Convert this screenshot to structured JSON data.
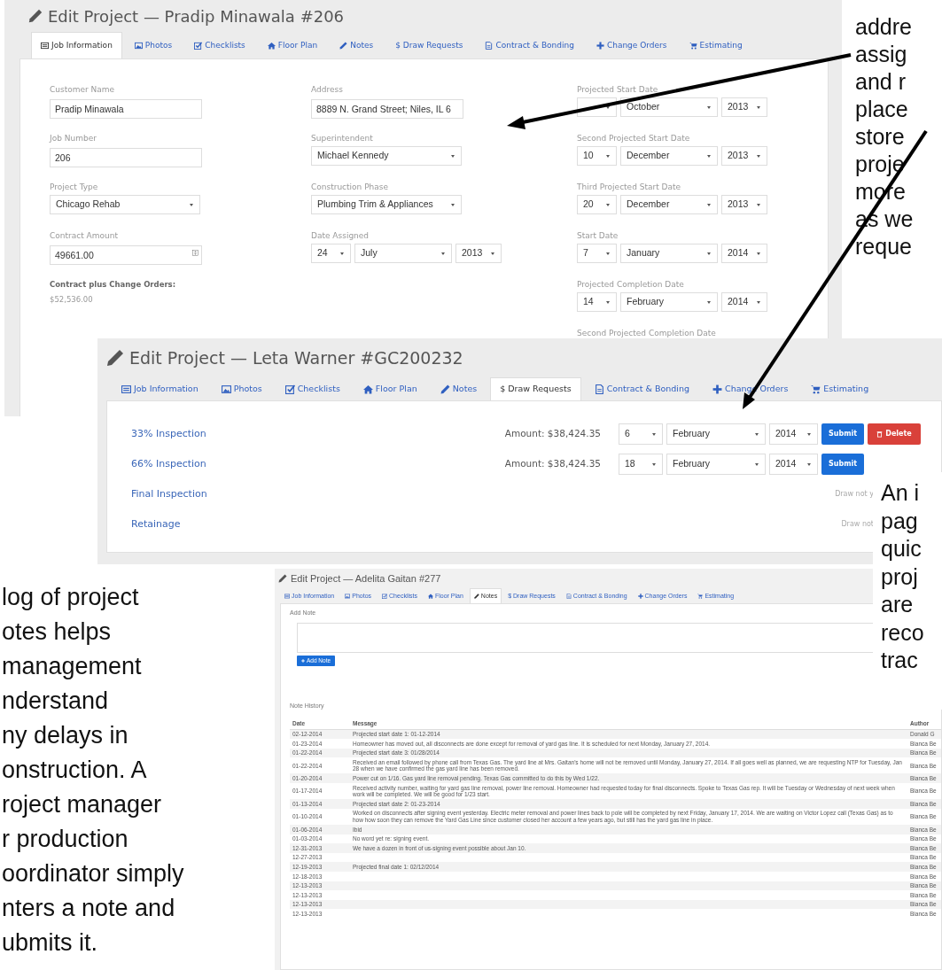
{
  "job_information_screen": {
    "title": "Edit Project — Pradip Minawala #206",
    "tabs": [
      {
        "label": "Job Information",
        "selected": true
      },
      {
        "label": "Photos",
        "selected": false
      },
      {
        "label": "Checklists",
        "selected": false
      },
      {
        "label": "Floor Plan",
        "selected": false
      },
      {
        "label": "Notes",
        "selected": false
      },
      {
        "label": "$ Draw Requests",
        "selected": false
      },
      {
        "label": "Contract & Bonding",
        "selected": false
      },
      {
        "label": "Change Orders",
        "selected": false
      },
      {
        "label": "Estimating",
        "selected": false
      }
    ],
    "columns": [
      [
        {
          "kind": "text",
          "label": "Customer Name",
          "value": "Pradip Minawala"
        },
        {
          "kind": "text",
          "label": "Job Number",
          "value": "206"
        },
        {
          "kind": "select",
          "label": "Project Type",
          "value": "Chicago Rehab"
        },
        {
          "kind": "number",
          "label": "Contract Amount",
          "value": "49661.00"
        },
        {
          "kind": "summary",
          "label": "Contract plus Change Orders:",
          "value": "$52,536.00"
        }
      ],
      [
        {
          "kind": "text",
          "label": "Address",
          "value": "8889 N. Grand Street; Niles, IL 6"
        },
        {
          "kind": "select",
          "label": "Superintendent",
          "value": "Michael Kennedy"
        },
        {
          "kind": "select",
          "label": "Construction Phase",
          "value": "Plumbing Trim & Appliances"
        },
        {
          "kind": "date",
          "label": "Date Assigned",
          "day": "24",
          "month": "July",
          "year": "2013"
        }
      ],
      [
        {
          "kind": "date",
          "label": "Projected Start Date",
          "month": "October",
          "year": "2013"
        },
        {
          "kind": "date",
          "label": "Second Projected Start Date",
          "day": "10",
          "month": "December",
          "year": "2013"
        },
        {
          "kind": "date",
          "label": "Third Projected Start Date",
          "day": "20",
          "month": "December",
          "year": "2013"
        },
        {
          "kind": "date",
          "label": "Start Date",
          "day": "7",
          "month": "January",
          "year": "2014"
        },
        {
          "kind": "date",
          "label": "Projected Completion Date",
          "day": "14",
          "month": "February",
          "year": "2014"
        },
        {
          "kind": "label",
          "label": "Second Projected Completion Date"
        }
      ]
    ]
  },
  "draw_requests_screen": {
    "title": "Edit Project — Leta Warner #GC200232",
    "tabs": [
      {
        "label": "Job Information",
        "selected": false
      },
      {
        "label": "Photos",
        "selected": false
      },
      {
        "label": "Checklists",
        "selected": false
      },
      {
        "label": "Floor Plan",
        "selected": false
      },
      {
        "label": "Notes",
        "selected": false
      },
      {
        "label": "$ Draw Requests",
        "selected": true
      },
      {
        "label": "Contract & Bonding",
        "selected": false
      },
      {
        "label": "Change Orders",
        "selected": false
      },
      {
        "label": "Estimating",
        "selected": false
      }
    ],
    "draws": [
      {
        "name": "33% Inspection",
        "amount": "Amount: $38,424.35",
        "day": "6",
        "month": "February",
        "year": "2014",
        "buttons": [
          {
            "kind": "submit",
            "label": "Submit"
          },
          {
            "kind": "delete",
            "label": "Delete"
          }
        ]
      },
      {
        "name": "66% Inspection",
        "amount": "Amount: $38,424.35",
        "day": "18",
        "month": "February",
        "year": "2014",
        "buttons": [
          {
            "kind": "submit",
            "label": "Submit"
          }
        ]
      },
      {
        "name": "Final Inspection",
        "status": "Draw not y"
      },
      {
        "name": "Retainage",
        "status": "Draw not"
      }
    ]
  },
  "notes_screen": {
    "title": "Edit Project — Adelita Gaitan #277",
    "tabs": [
      {
        "label": "Job Information",
        "selected": false
      },
      {
        "label": "Photos",
        "selected": false
      },
      {
        "label": "Checklists",
        "selected": false
      },
      {
        "label": "Floor Plan",
        "selected": false
      },
      {
        "label": "Notes",
        "selected": true
      },
      {
        "label": "$ Draw Requests",
        "selected": false
      },
      {
        "label": "Contract & Bonding",
        "selected": false
      },
      {
        "label": "Change Orders",
        "selected": false
      },
      {
        "label": "Estimating",
        "selected": false
      }
    ],
    "add_note_label": "Add Note",
    "add_button": "Add Note",
    "history_label": "Note History",
    "columns": [
      "Date",
      "Message",
      "Author"
    ],
    "rows": [
      {
        "date": "02-12-2014",
        "message": "Projected start date 1: 01-12-2014",
        "author": "Donald G"
      },
      {
        "date": "01-23-2014",
        "message": "Homeowner has moved out, all disconnects are done except for removal of yard gas line. It is scheduled for next Monday, January 27, 2014.",
        "author": "Bianca Be"
      },
      {
        "date": "01-22-2014",
        "message": "Projected start date 3: 01/28/2014",
        "author": "Bianca Be"
      },
      {
        "date": "01-22-2014",
        "message": "Received an email followed by phone call from Texas Gas. The yard line at Mrs. Gaitan's home will not be removed until Monday, January 27, 2014. If all goes well as planned, we are requesting NTP for Tuesday, Jan 28 when we have confirmed the gas yard line has been removed.",
        "author": "Bianca Be"
      },
      {
        "date": "01-20-2014",
        "message": "Power cut on 1/16. Gas yard line removal pending. Texas Gas committed to do this by Wed 1/22.",
        "author": "Bianca Be"
      },
      {
        "date": "01-17-2014",
        "message": "Received activity number, waiting for yard gas line removal, power line removal. Homeowner had requested today for final disconnects. Spoke to Texas Gas rep. It will be Tuesday or Wednesday of next week when work will be completed. We will be good for 1/23 start.",
        "author": "Bianca Be"
      },
      {
        "date": "01-13-2014",
        "message": "Projected start date 2: 01-23-2014",
        "author": "Bianca Be"
      },
      {
        "date": "01-10-2014",
        "message": "Worked on disconnects after signing event yesterday. Electric meter removal and power lines back to pole will be completed by next Friday, January 17, 2014. We are waiting on Victor Lopez call (Texas Gas) as to how how soon they can remove the Yard Gas Line since customer closed her account a few years ago, but still has the yard gas line in place.",
        "author": "Bianca Be"
      },
      {
        "date": "01-06-2014",
        "message": "Ibid",
        "author": "Bianca Be"
      },
      {
        "date": "01-03-2014",
        "message": "No word yet re: signing event.",
        "author": "Bianca Be"
      },
      {
        "date": "12-31-2013",
        "message": "We have a dozen in front of us-signing event possible about Jan 10.",
        "author": "Bianca Be"
      },
      {
        "date": "12-27-2013",
        "author": "Bianca Be"
      },
      {
        "date": "12-19-2013",
        "message": "Projected final date 1: 02/12/2014",
        "author": "Bianca Be"
      },
      {
        "date": "12-18-2013",
        "author": "Bianca Be"
      },
      {
        "date": "12-13-2013",
        "author": "Bianca Be"
      },
      {
        "date": "12-13-2013",
        "author": "Bianca Be"
      },
      {
        "date": "12-13-2013",
        "author": "Bianca Be"
      },
      {
        "date": "12-13-2013",
        "author": "Bianca Be"
      }
    ]
  },
  "annotations": [
    {
      "kind": "top_right",
      "lines": [
        "addre",
        "assig",
        "and r",
        "place",
        "store",
        "proje",
        "more",
        "as we",
        "reque"
      ]
    },
    {
      "kind": "middle_right",
      "lines": [
        "An i",
        "pag",
        "quic",
        "proj",
        "are",
        "reco",
        "trac"
      ]
    },
    {
      "kind": "left",
      "lines": [
        "log of project",
        "otes helps",
        "management",
        "nderstand",
        "ny delays in",
        "onstruction. A",
        "roject manager",
        "r production",
        "oordinator simply",
        "nters a note and",
        "ubmits it."
      ]
    }
  ]
}
